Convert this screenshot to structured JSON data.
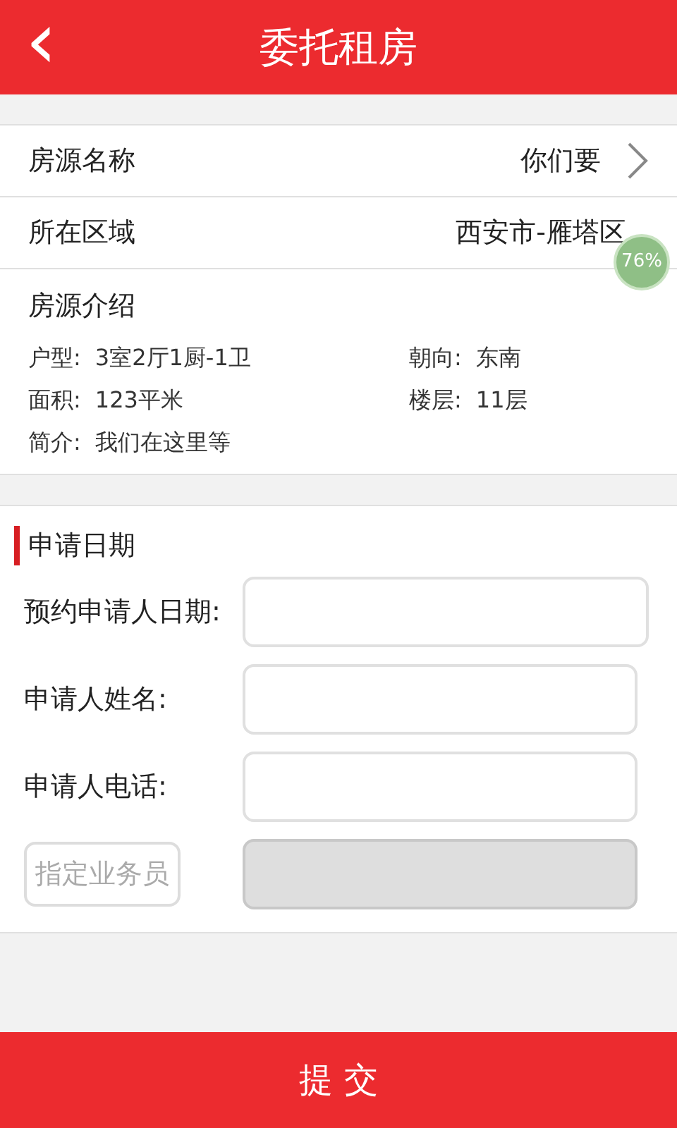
{
  "header": {
    "back": "‹",
    "title": "委托租房"
  },
  "property_rows": [
    {
      "label": "房源名称",
      "value": "你们要",
      "chevron": true
    },
    {
      "label": "所在区域",
      "value": "西安市-雁塔区",
      "chevron": false
    }
  ],
  "intro": {
    "title": "房源介绍",
    "details": [
      {
        "label": "户型:",
        "value": "3室2厅1厨-1卫"
      },
      {
        "label": "朝向:",
        "value": "东南"
      },
      {
        "label": "面积:",
        "value": "123平米"
      },
      {
        "label": "楼层:",
        "value": "11层"
      },
      {
        "label": "简介:",
        "value": "我们在这里等"
      }
    ]
  },
  "floating_badge": "76%",
  "form": {
    "title": "申请日期",
    "fields": [
      {
        "kind": "label",
        "label": "预约申请人日期:",
        "disabled": false
      },
      {
        "kind": "label",
        "label": "申请人姓名:",
        "disabled": false
      },
      {
        "kind": "label",
        "label": "申请人电话:",
        "disabled": false
      },
      {
        "kind": "button",
        "label": "指定业务员",
        "disabled": true
      }
    ]
  },
  "submit": "提 交"
}
